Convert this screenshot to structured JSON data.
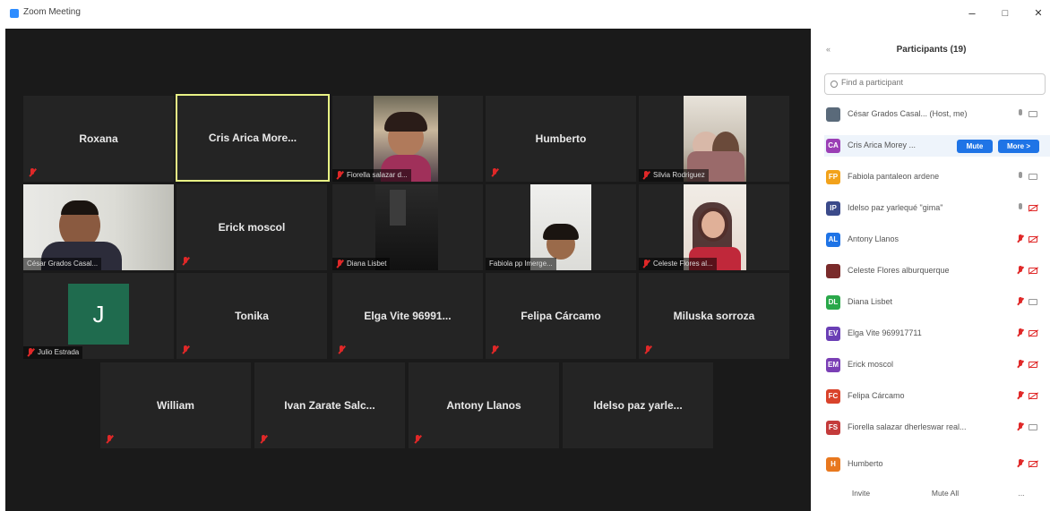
{
  "window": {
    "title": "Zoom Meeting",
    "minimize": "–",
    "maximize": "□",
    "close": "✕"
  },
  "gallery": {
    "tiles": [
      {
        "name": "Roxana"
      },
      {
        "name": "Cris  Arica More..."
      },
      {
        "label": "Fiorella salazar d..."
      },
      {
        "name": "Humberto"
      },
      {
        "label": "Silvia Rodriguez"
      },
      {
        "label": "César Grados Casal..."
      },
      {
        "name": "Erick moscol"
      },
      {
        "label": "Diana Lisbet"
      },
      {
        "label": "Fabiola pp lmerge..."
      },
      {
        "label": "Celeste Flores al..."
      },
      {
        "label": "Julio Estrada",
        "avatar": "J"
      },
      {
        "name": "Tonika"
      },
      {
        "name": "Elga Vite 96991..."
      },
      {
        "name": "Felipa Cárcamo"
      },
      {
        "name": "Miluska sorroza"
      },
      {
        "name": "William"
      },
      {
        "name": "Ivan  Zarate Salc..."
      },
      {
        "name": "Antony Llanos"
      },
      {
        "name": "Idelso  paz  yarle..."
      }
    ]
  },
  "participants": {
    "collapse_icon": "«",
    "title": "Participants (19)",
    "search_placeholder": "Find a participant",
    "mute_label": "Mute",
    "more_label": "More >",
    "list": [
      {
        "initials": "",
        "name": "César Grados Casal... (Host, me)",
        "color": "#5a6a7a",
        "mic": "on",
        "cam": "on"
      },
      {
        "initials": "CA",
        "name": "Cris Arica Morey ...",
        "color": "#9b3fb5",
        "mic": "",
        "cam": ""
      },
      {
        "initials": "FP",
        "name": "Fabiola pantaleon ardene",
        "color": "#f2a21b",
        "mic": "on",
        "cam": "on"
      },
      {
        "initials": "IP",
        "name": "Idelso paz yarlequé \"gima\"",
        "color": "#3b4a8a",
        "mic": "on",
        "cam": "off"
      },
      {
        "initials": "AL",
        "name": "Antony Llanos",
        "color": "#1f74e6",
        "mic": "off",
        "cam": "off"
      },
      {
        "initials": "",
        "name": "Celeste Flores alburquerque",
        "color": "#7a2b2b",
        "mic": "off",
        "cam": "off"
      },
      {
        "initials": "DL",
        "name": "Diana Lisbet",
        "color": "#2aa84a",
        "mic": "off",
        "cam": "on"
      },
      {
        "initials": "EV",
        "name": "Elga Vite 969917711",
        "color": "#6a3fb5",
        "mic": "off",
        "cam": "off"
      },
      {
        "initials": "EM",
        "name": "Erick moscol",
        "color": "#7a3fb5",
        "mic": "off",
        "cam": "off"
      },
      {
        "initials": "FC",
        "name": "Felipa Cárcamo",
        "color": "#d9432b",
        "mic": "off",
        "cam": "off"
      },
      {
        "initials": "FS",
        "name": "Fiorella salazar dherleswar real...",
        "color": "#c43b3b",
        "mic": "off",
        "cam": "on"
      },
      {
        "initials": "H",
        "name": "Humberto",
        "color": "#e8781e",
        "mic": "off",
        "cam": "off"
      }
    ],
    "invite_label": "Invite",
    "mute_all_label": "Mute All",
    "more_icon": "..."
  }
}
